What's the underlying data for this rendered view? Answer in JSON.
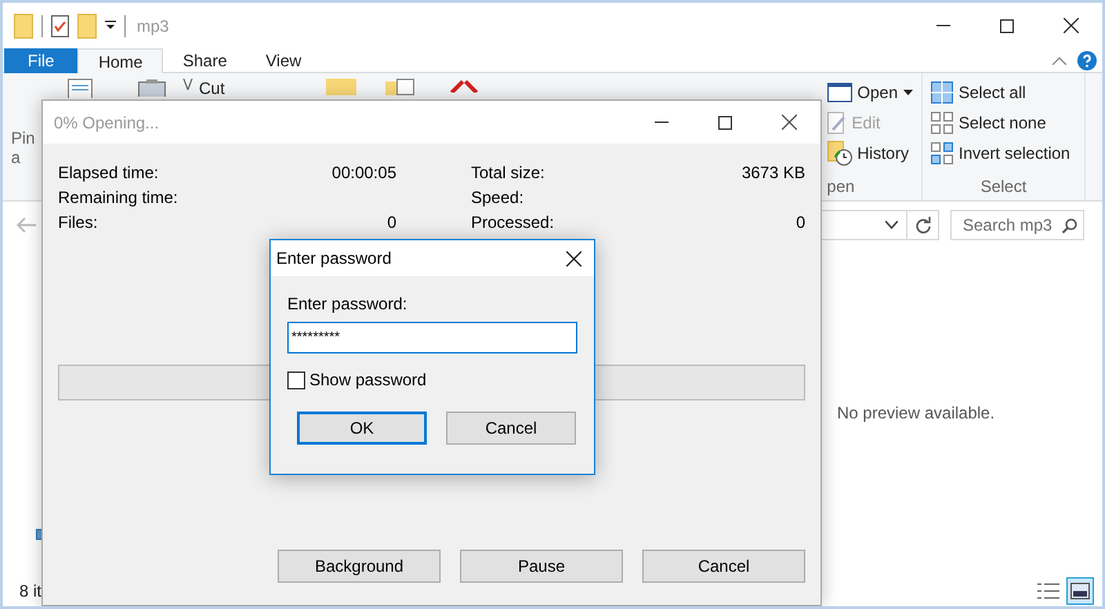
{
  "explorer": {
    "title": "mp3",
    "ribbon_tabs": [
      {
        "label": "File",
        "kind": "file",
        "selected": false
      },
      {
        "label": "Home",
        "kind": "tab",
        "selected": true
      },
      {
        "label": "Share",
        "kind": "tab",
        "selected": false
      },
      {
        "label": "View",
        "kind": "tab",
        "selected": false
      }
    ],
    "ribbon": {
      "pin_fragments": [
        "Pin",
        "a"
      ],
      "cut_label": "Cut",
      "open_group": {
        "label": "pen",
        "items": [
          {
            "label": "Open",
            "kind": "open",
            "dropdown": true,
            "disabled": false
          },
          {
            "label": "Edit",
            "kind": "edit",
            "dropdown": false,
            "disabled": true
          },
          {
            "label": "History",
            "kind": "history",
            "dropdown": false,
            "disabled": false
          }
        ]
      },
      "select_group": {
        "label": "Select",
        "items": [
          {
            "label": "Select all",
            "kind": "all"
          },
          {
            "label": "Select none",
            "kind": "none"
          },
          {
            "label": "Invert selection",
            "kind": "invert"
          }
        ]
      }
    },
    "search": {
      "placeholder": "Search mp3"
    },
    "preview_message": "No preview available.",
    "status_bar": {
      "item_count": "8 it",
      "views": [
        {
          "kind": "details",
          "selected": false
        },
        {
          "kind": "large_icons",
          "selected": true
        }
      ]
    }
  },
  "progress_dialog": {
    "title": "0% Opening...",
    "stats_left": [
      {
        "label": "Elapsed time:",
        "value": "00:00:05"
      },
      {
        "label": "Remaining time:"
      },
      {
        "label": "Files:",
        "value": "0"
      }
    ],
    "stats_right": [
      {
        "label": "Total size:",
        "value": "3673 KB"
      },
      {
        "label": "Speed:"
      },
      {
        "label": "Processed:",
        "value": "0"
      }
    ],
    "progress": {
      "level": 0
    },
    "buttons": [
      "Background",
      "Pause",
      "Cancel"
    ]
  },
  "password_dialog": {
    "title": "Enter password",
    "field_label": "Enter password:",
    "value": "*********",
    "show_password": {
      "label": "Show password",
      "checked": false
    },
    "buttons": [
      {
        "label": "OK",
        "default": true
      },
      {
        "label": "Cancel",
        "default": false
      }
    ]
  }
}
